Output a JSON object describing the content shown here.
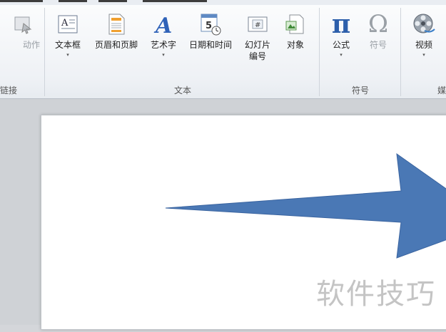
{
  "ribbon": {
    "groups": {
      "links": {
        "label": "链接"
      },
      "text": {
        "label": "文本"
      },
      "symbols": {
        "label": "符号"
      },
      "media": {
        "label": "媒体"
      }
    },
    "buttons": {
      "action": {
        "label": "动作"
      },
      "textbox": {
        "label": "文本框"
      },
      "header_footer": {
        "label": "页眉和页脚"
      },
      "wordart": {
        "label": "艺术字"
      },
      "datetime": {
        "label": "日期和时间",
        "icon_text": "5"
      },
      "slide_number": {
        "label_line1": "幻灯片",
        "label_line2": "编号",
        "icon_text": "#"
      },
      "object": {
        "label": "对象"
      },
      "equation": {
        "label": "公式",
        "icon_text": "π"
      },
      "symbol": {
        "label": "符号",
        "icon_text": "Ω"
      },
      "video": {
        "label": "视频"
      }
    },
    "dropdown_glyph": "▾"
  },
  "watermark": "软件技巧",
  "colors": {
    "arrow_fill": "#4a78b5",
    "arrow_stroke": "#3a64a0",
    "ribbon_bg": "#f3f5f8"
  }
}
